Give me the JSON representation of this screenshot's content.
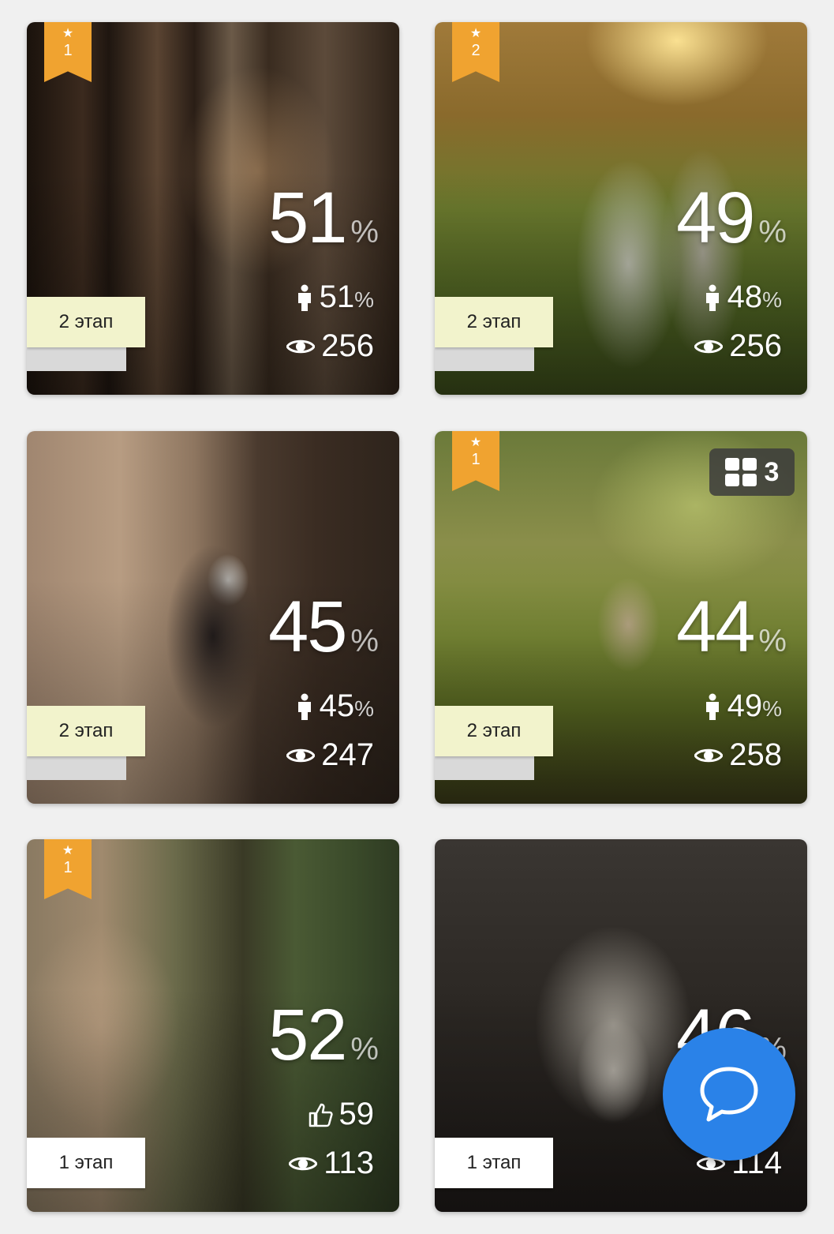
{
  "cards": [
    {
      "rank": "1",
      "stage": "2 этап",
      "score": "51",
      "score_unit": "%",
      "metric": "51",
      "metric_unit": "%",
      "views": "256"
    },
    {
      "rank": "2",
      "stage": "2 этап",
      "score": "49",
      "score_unit": "%",
      "metric": "48",
      "metric_unit": "%",
      "views": "256"
    },
    {
      "stage": "2 этап",
      "score": "45",
      "score_unit": "%",
      "metric": "45",
      "metric_unit": "%",
      "views": "247"
    },
    {
      "rank": "1",
      "stage": "2 этап",
      "score": "44",
      "score_unit": "%",
      "metric": "49",
      "metric_unit": "%",
      "views": "258",
      "gallery_count": "3"
    },
    {
      "rank": "1",
      "stage": "1 этап",
      "score": "52",
      "score_unit": "%",
      "likes": "59",
      "views": "113"
    },
    {
      "stage": "1 этап",
      "score": "46",
      "score_unit": "%",
      "views": "114"
    }
  ],
  "icons": {
    "ribbon": "star-icon",
    "metric": "person-icon",
    "likes": "thumbs-up-icon",
    "views": "eye-icon",
    "gallery": "grid-icon",
    "chat": "chat-bubble-icon"
  },
  "colors": {
    "ribbon": "#f0a330",
    "stage_final": "#f2f3cc",
    "stage_initial": "#ffffff",
    "chat_button": "#2a82e8"
  }
}
